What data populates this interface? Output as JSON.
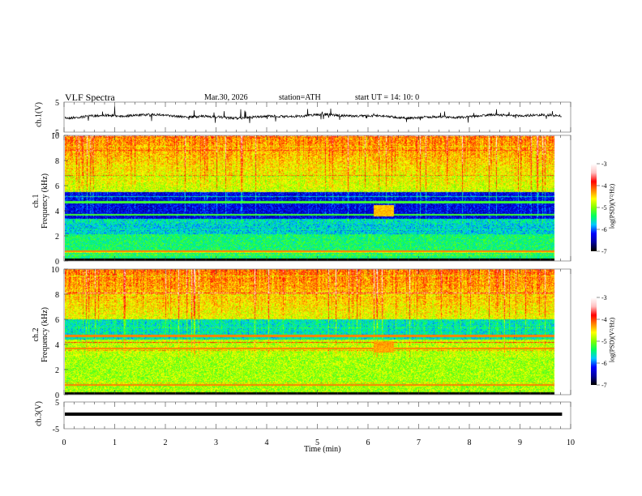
{
  "header": {
    "title": "VLF  Spectra",
    "date": "Mar.30, 2026",
    "station": "station=ATH",
    "start": "start  UT  =   14: 10: 0"
  },
  "chart_data": [
    {
      "type": "line",
      "ylabel": "ch.1(V)",
      "ylim": [
        -5,
        5
      ],
      "yticks": [
        "5",
        "-5"
      ],
      "xlim": [
        0,
        10
      ],
      "description_mean_level": 0,
      "color": "#000000"
    },
    {
      "type": "heatmap",
      "ylabel": "ch.1\nFrequency  (kHz)",
      "ylabel_lines": [
        "ch.1",
        "Frequency  (kHz)"
      ],
      "ylim": [
        0,
        10
      ],
      "yticks": [
        "0",
        "2",
        "4",
        "6",
        "8",
        "10"
      ],
      "xlim": [
        0,
        10
      ],
      "data_xmax": 9.83,
      "colorbar": {
        "label": "log(PSD)(V²/Hz)",
        "range": [
          -7,
          -3
        ],
        "ticks": [
          "-3",
          "-4",
          "-5",
          "-6",
          "-7"
        ]
      }
    },
    {
      "type": "heatmap",
      "ylabel_lines": [
        "ch.2",
        "Frequency  (kHz)"
      ],
      "ylim": [
        0,
        10
      ],
      "yticks": [
        "0",
        "2",
        "4",
        "6",
        "8",
        "10"
      ],
      "xlim": [
        0,
        10
      ],
      "data_xmax": 9.83,
      "colorbar": {
        "label": "log(PSD)(V²/Hz)",
        "range": [
          -7,
          -3
        ],
        "ticks": [
          "-3",
          "-4",
          "-5",
          "-6",
          "-7"
        ]
      }
    },
    {
      "type": "line",
      "ylabel": "ch.3(V)",
      "ylim": [
        -5,
        5
      ],
      "yticks": [
        "5",
        "-5"
      ],
      "xlim": [
        0,
        10
      ],
      "level": -1.5,
      "color": "#000000"
    }
  ],
  "xaxis": {
    "label": "Time  (min)",
    "ticks": [
      "0",
      "1",
      "2",
      "3",
      "4",
      "5",
      "6",
      "7",
      "8",
      "9",
      "10"
    ]
  },
  "colormap": [
    "#000000",
    "#0000a0",
    "#0000ff",
    "#00c8ff",
    "#00ff60",
    "#80ff00",
    "#ffff00",
    "#ff8000",
    "#ff0000",
    "#ffc0c0",
    "#ffffff"
  ]
}
